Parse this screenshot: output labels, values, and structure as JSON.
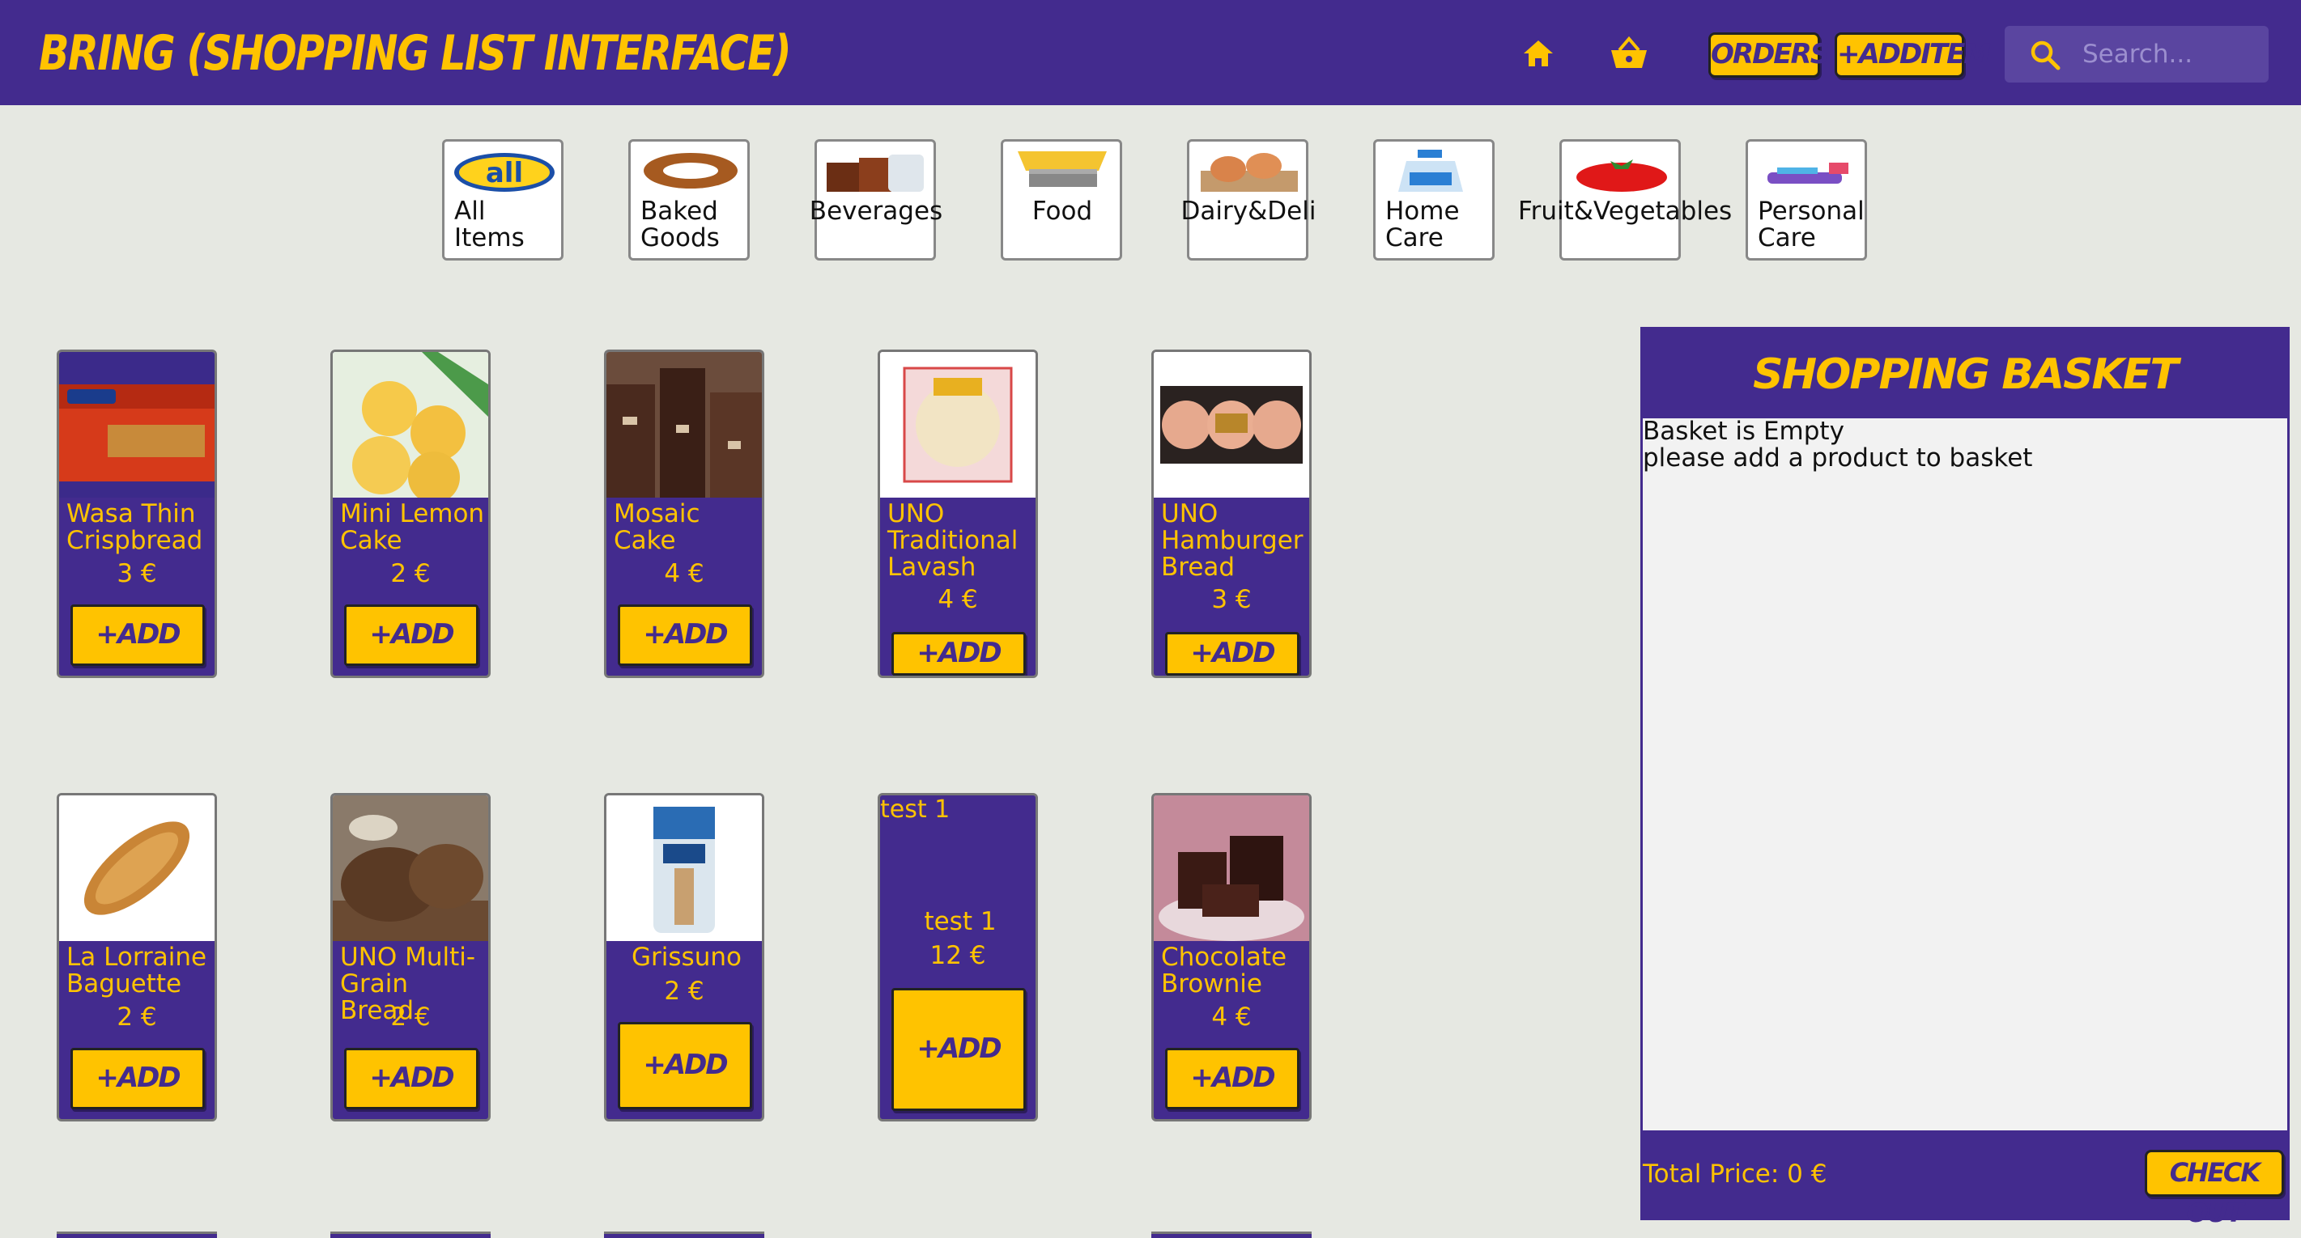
{
  "header": {
    "title": "BRING (SHOPPING LIST INTERFACE)",
    "home_icon": "home-icon",
    "basket_icon": "basket-icon",
    "orders_label": "ORDERS",
    "add_item_label": "+ADDITEM",
    "search_placeholder": "Search..."
  },
  "categories": [
    {
      "label": "All\nItems",
      "icon": "all-logo-icon"
    },
    {
      "label": "Baked\nGoods",
      "icon": "simit-bread-icon"
    },
    {
      "label": "Beverages",
      "icon": "drinks-icon"
    },
    {
      "label": "Food",
      "icon": "pasta-icon"
    },
    {
      "label": "Dairy&Deli",
      "icon": "eggs-icon"
    },
    {
      "label": "Home\nCare",
      "icon": "detergent-bottle-icon"
    },
    {
      "label": "Fruit&Vegetables",
      "icon": "tomato-icon"
    },
    {
      "label": "Personal\nCare",
      "icon": "toothbrush-icon"
    }
  ],
  "products": [
    {
      "name": "Wasa Thin Crispbread",
      "price": "3 €",
      "add": "+ADD"
    },
    {
      "name": "Mini Lemon Cake",
      "price": "2 €",
      "add": "+ADD"
    },
    {
      "name": "Mosaic Cake",
      "price": "4 €",
      "add": "+ADD"
    },
    {
      "name": "UNO Traditional Lavash",
      "price": "4 €",
      "add": "+ADD"
    },
    {
      "name": "UNO Hamburger Bread",
      "price": "3 €",
      "add": "+ADD"
    },
    {
      "name": "La Lorraine Baguette",
      "price": "2 €",
      "add": "+ADD"
    },
    {
      "name": "UNO Multi-Grain Bread",
      "price": "2 €",
      "add": "+ADD"
    },
    {
      "name": "Grissuno",
      "price": "2 €",
      "add": "+ADD"
    },
    {
      "name": "test 1",
      "price": "12 €",
      "add": "+ADD",
      "alt": "test 1"
    },
    {
      "name": "Chocolate Brownie",
      "price": "4 €",
      "add": "+ADD"
    }
  ],
  "basket": {
    "title": "SHOPPING BASKET",
    "empty_line1": "Basket is Empty",
    "empty_line2": "please add a product to basket",
    "total_label": "Total Price: 0 €",
    "checkout_label": "CHECK OUT"
  },
  "colors": {
    "primary": "#432b8e",
    "accent": "#ffc300",
    "background": "#e6e8e2"
  }
}
